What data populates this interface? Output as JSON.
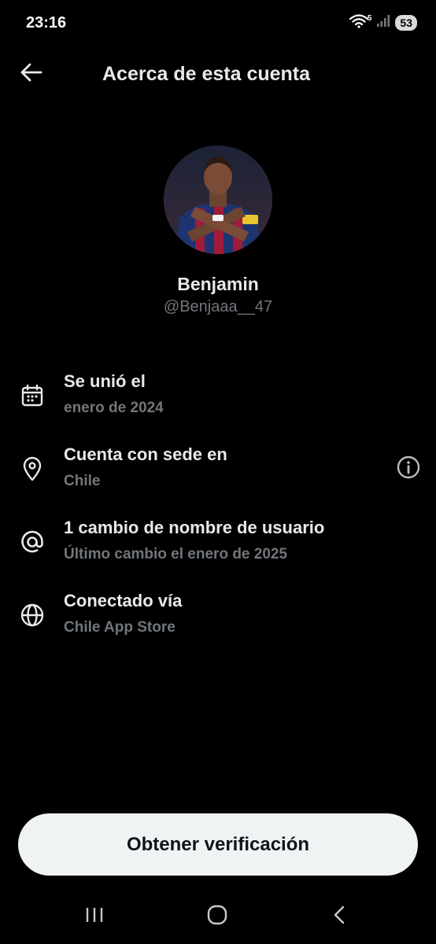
{
  "status_bar": {
    "time": "23:16",
    "wifi_badge": "5",
    "battery": "53"
  },
  "header": {
    "title": "Acerca de esta cuenta"
  },
  "profile": {
    "name": "Benjamin",
    "handle": "@Benjaaa__47"
  },
  "info": [
    {
      "icon": "calendar-icon",
      "title": "Se unió el",
      "subtitle": "enero de 2024"
    },
    {
      "icon": "location-pin-icon",
      "title": "Cuenta con sede en",
      "subtitle": "Chile"
    },
    {
      "icon": "at-sign-icon",
      "title": "1 cambio de nombre de usuario",
      "subtitle": "Último cambio el enero de 2025"
    },
    {
      "icon": "globe-icon",
      "title": "Conectado vía",
      "subtitle": "Chile App Store"
    }
  ],
  "actions": {
    "verify_label": "Obtener verificación"
  },
  "colors": {
    "background": "#000000",
    "primary_text": "#e7e9ea",
    "secondary_text": "#71767b",
    "button_bg": "#eff3f4",
    "button_text": "#0f1419"
  }
}
